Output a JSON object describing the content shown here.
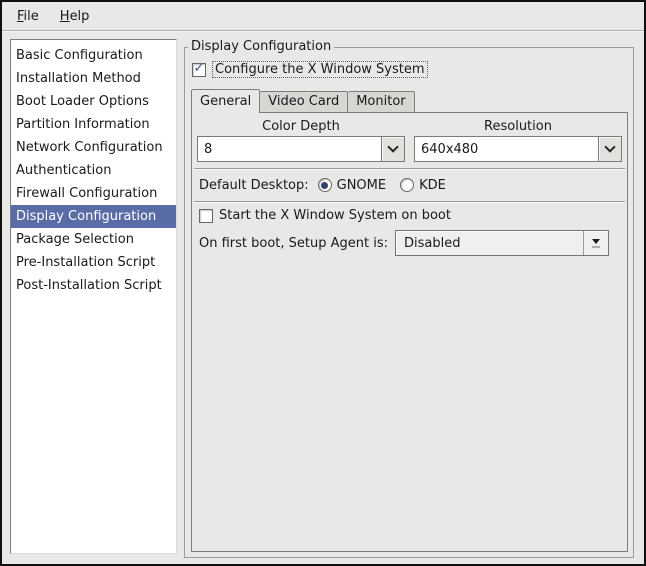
{
  "menu": {
    "items": [
      {
        "label": "File",
        "accel": "F",
        "rest": "ile"
      },
      {
        "label": "Help",
        "accel": "H",
        "rest": "elp"
      }
    ]
  },
  "sidebar": {
    "items": [
      "Basic Configuration",
      "Installation Method",
      "Boot Loader Options",
      "Partition Information",
      "Network Configuration",
      "Authentication",
      "Firewall Configuration",
      "Display Configuration",
      "Package Selection",
      "Pre-Installation Script",
      "Post-Installation Script"
    ],
    "selected": "Display Configuration"
  },
  "panel": {
    "frame_title": "Display Configuration",
    "configure_x": {
      "label": "Configure the X Window System",
      "checked": true
    },
    "tabs": {
      "general": "General",
      "video_card": "Video Card",
      "monitor": "Monitor",
      "active": "General"
    },
    "general": {
      "color_depth_label": "Color Depth",
      "color_depth_value": "8",
      "resolution_label": "Resolution",
      "resolution_value": "640x480",
      "default_desktop_label": "Default Desktop:",
      "desktop_options": [
        {
          "label": "GNOME",
          "selected": true
        },
        {
          "label": "KDE",
          "selected": false
        }
      ],
      "start_x_label": "Start the X Window System on boot",
      "start_x_checked": false,
      "setup_agent_label": "On first boot, Setup Agent is:",
      "setup_agent_value": "Disabled"
    }
  },
  "colors": {
    "bg": "#e8e8e6",
    "selection_bg": "#5a6ca6",
    "check_blue": "#2f4f9e",
    "radio_dot": "#31426e"
  }
}
